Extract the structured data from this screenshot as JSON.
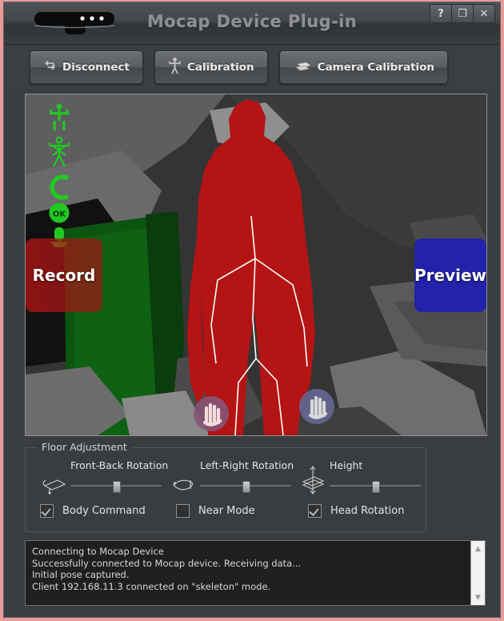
{
  "window": {
    "title": "Mocap Device Plug-in",
    "controls": [
      {
        "name": "help-button",
        "glyph": "?"
      },
      {
        "name": "restore-button",
        "glyph": "❐"
      },
      {
        "name": "close-button",
        "glyph": "✕"
      }
    ]
  },
  "toolbar": {
    "disconnect_label": "Disconnect",
    "calibration_label": "Calibration",
    "camera_calibration_label": "Camera Calibration"
  },
  "viewport": {
    "record_label": "Record",
    "preview_label": "Preview",
    "status_icons": [
      "skeleton-tracked-icon",
      "skeleton-pose-icon",
      "c-shape-icon",
      "ok-badge-icon",
      "mic-stand-icon"
    ],
    "accent_colors": {
      "player_silhouette": "#b41414",
      "player_two_silhouette": "#0f5a12",
      "skeleton_line": "#ffffff",
      "record_button": "#be1414",
      "preview_button": "#2222aa",
      "status_icon": "#22c822"
    }
  },
  "floor_adjustment": {
    "group_title": "Floor Adjustment",
    "sliders": [
      {
        "label": "Front-Back Rotation",
        "icon": "plane-tilt-icon",
        "value": 50
      },
      {
        "label": "Left-Right Rotation",
        "icon": "plane-roll-icon",
        "value": 50
      },
      {
        "label": "Height",
        "icon": "plane-height-icon",
        "value": 50
      }
    ],
    "checkboxes": [
      {
        "label": "Body Command",
        "checked": true
      },
      {
        "label": "Near Mode",
        "checked": false
      },
      {
        "label": "Head Rotation",
        "checked": true
      }
    ]
  },
  "console": {
    "lines": [
      "Connecting to Mocap Device",
      "Successfully connected to Mocap device. Receiving data...",
      "Initial pose captured.",
      "Client 192.168.11.3 connected on \"skeleton\" mode."
    ],
    "text": "Connecting to Mocap Device\nSuccessfully connected to Mocap device. Receiving data...\nInitial pose captured.\nClient 192.168.11.3 connected on \"skeleton\" mode.",
    "scroll_up_glyph": "▲",
    "scroll_down_glyph": "▼"
  }
}
